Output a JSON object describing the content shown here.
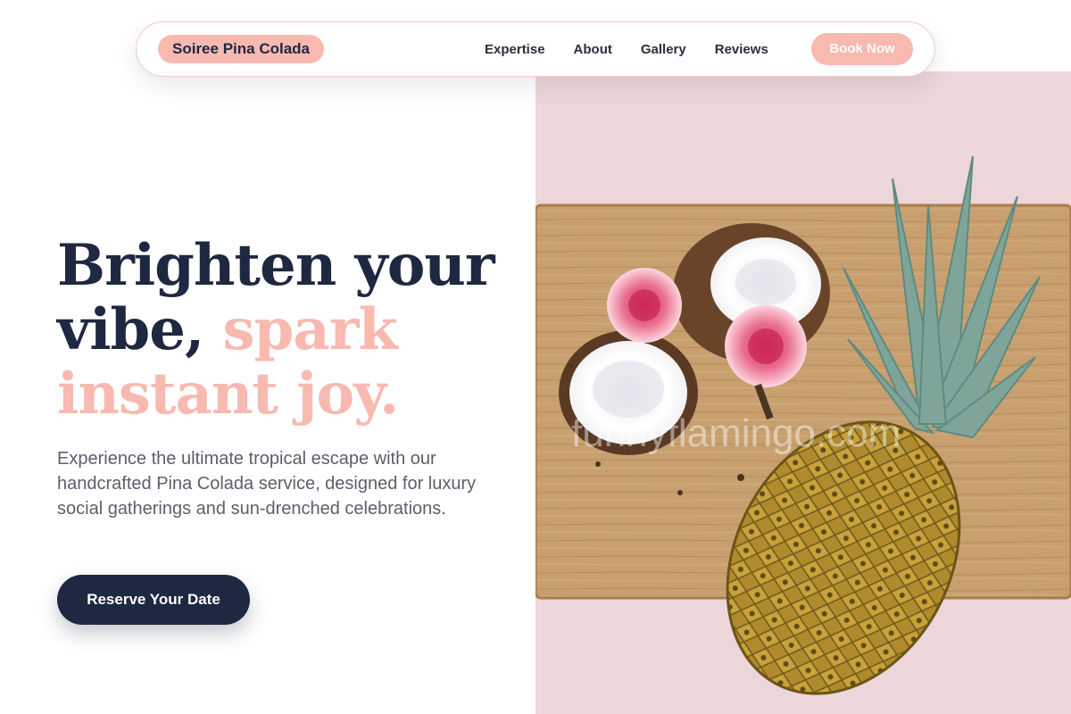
{
  "nav": {
    "brand": "Soiree Pina Colada",
    "links": [
      "Expertise",
      "About",
      "Gallery",
      "Reviews"
    ],
    "cta": "Book Now"
  },
  "hero": {
    "title_part1": "Brighten your",
    "title_part2": "vibe,",
    "title_accent1": "spark",
    "title_accent2": "instant joy.",
    "description": "Experience the ultimate tropical escape with our handcrafted Pina Colada service, designed for luxury social gatherings and sun-drenched celebrations.",
    "cta": "Reserve Your Date"
  },
  "image": {
    "watermark": "funnyflamingo.com"
  },
  "colors": {
    "navy": "#1e2840",
    "pink": "#f8b9b1",
    "image_bg": "#ecd6d9",
    "board": "#c69a68"
  }
}
